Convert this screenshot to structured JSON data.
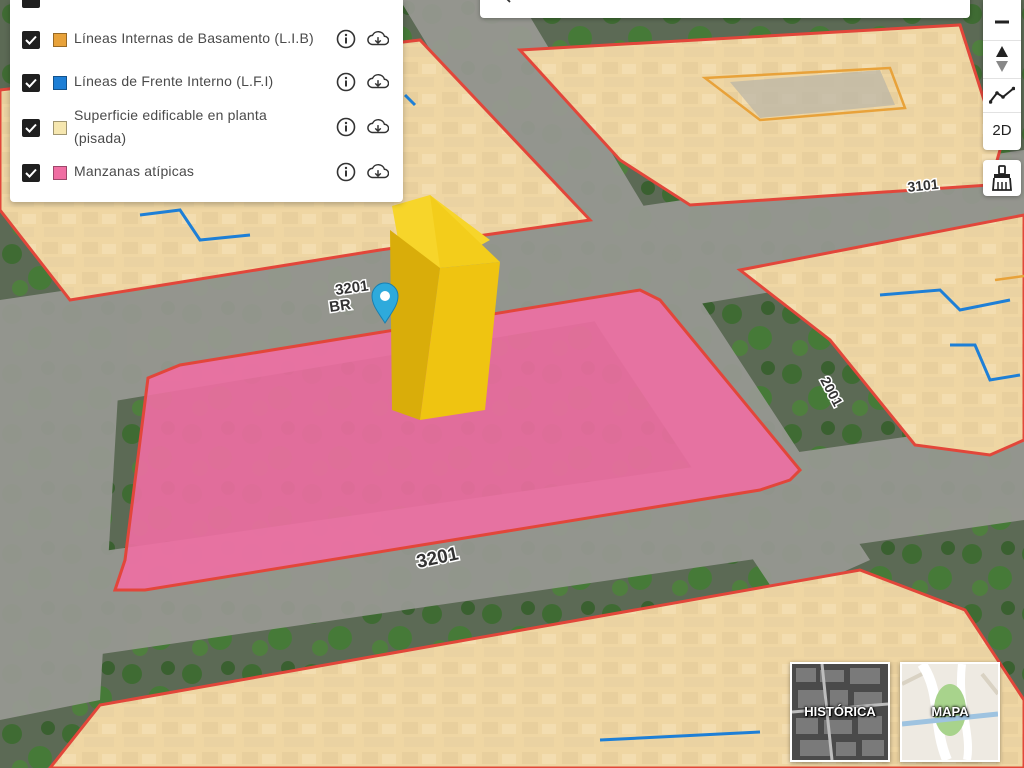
{
  "map": {
    "block_numbers": {
      "top_left": "3201",
      "top_right": "3101",
      "right": "2001",
      "bottom": "3201"
    },
    "street_fragment": "BR",
    "colors": {
      "lib": "#e8a23a",
      "lfi": "#1e7fd6",
      "pisada": "#f6e7b0",
      "atipica": "#f06ea3",
      "block_outline": "#e2463a",
      "building": "#f2c80e"
    }
  },
  "layers": [
    {
      "label": "Líneas Internas de Basamento (L.I.B)",
      "checked": true,
      "swatch": "#e8a23a",
      "info_icon": "info-icon",
      "download_icon": "cloud-download-icon"
    },
    {
      "label": "Líneas de Frente Interno (L.F.I)",
      "checked": true,
      "swatch": "#1e7fd6",
      "info_icon": "info-icon",
      "download_icon": "cloud-download-icon"
    },
    {
      "label": "Superficie edificable en planta (pisada)",
      "checked": true,
      "swatch": "#f6e7b0",
      "info_icon": "info-icon",
      "download_icon": "cloud-download-icon"
    },
    {
      "label": "Manzanas atípicas",
      "checked": true,
      "swatch": "#f06ea3",
      "info_icon": "info-icon",
      "download_icon": "cloud-download-icon"
    }
  ],
  "toolbar": {
    "zoom_out_icon": "minus-icon",
    "compass_icon": "compass-icon",
    "profile_icon": "elevation-profile-icon",
    "view_mode_label": "2D",
    "clear_icon": "brush-icon"
  },
  "basemaps": [
    {
      "label": "HISTÓRICA"
    },
    {
      "label": "MAPA"
    }
  ]
}
